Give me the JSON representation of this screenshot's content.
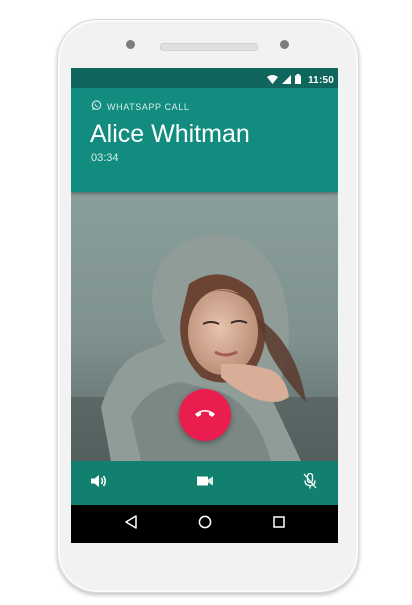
{
  "status_bar": {
    "time": "11:50",
    "icons": [
      "wifi-icon",
      "signal-icon",
      "battery-icon"
    ]
  },
  "call": {
    "app_label": "WHATSAPP CALL",
    "app_icon": "whatsapp-icon",
    "contact_name": "Alice Whitman",
    "duration": "03:34"
  },
  "controls": {
    "end_call_icon": "phone-hangup-icon",
    "speaker_icon": "speaker-icon",
    "video_icon": "video-camera-icon",
    "mute_icon": "microphone-off-icon"
  },
  "nav": {
    "icons": [
      "back-icon",
      "home-icon",
      "recents-icon"
    ]
  },
  "colors": {
    "header": "#128c7e",
    "status_bar": "#0f665c",
    "controls_bar": "#12806f",
    "end_call": "#e91e4f"
  }
}
